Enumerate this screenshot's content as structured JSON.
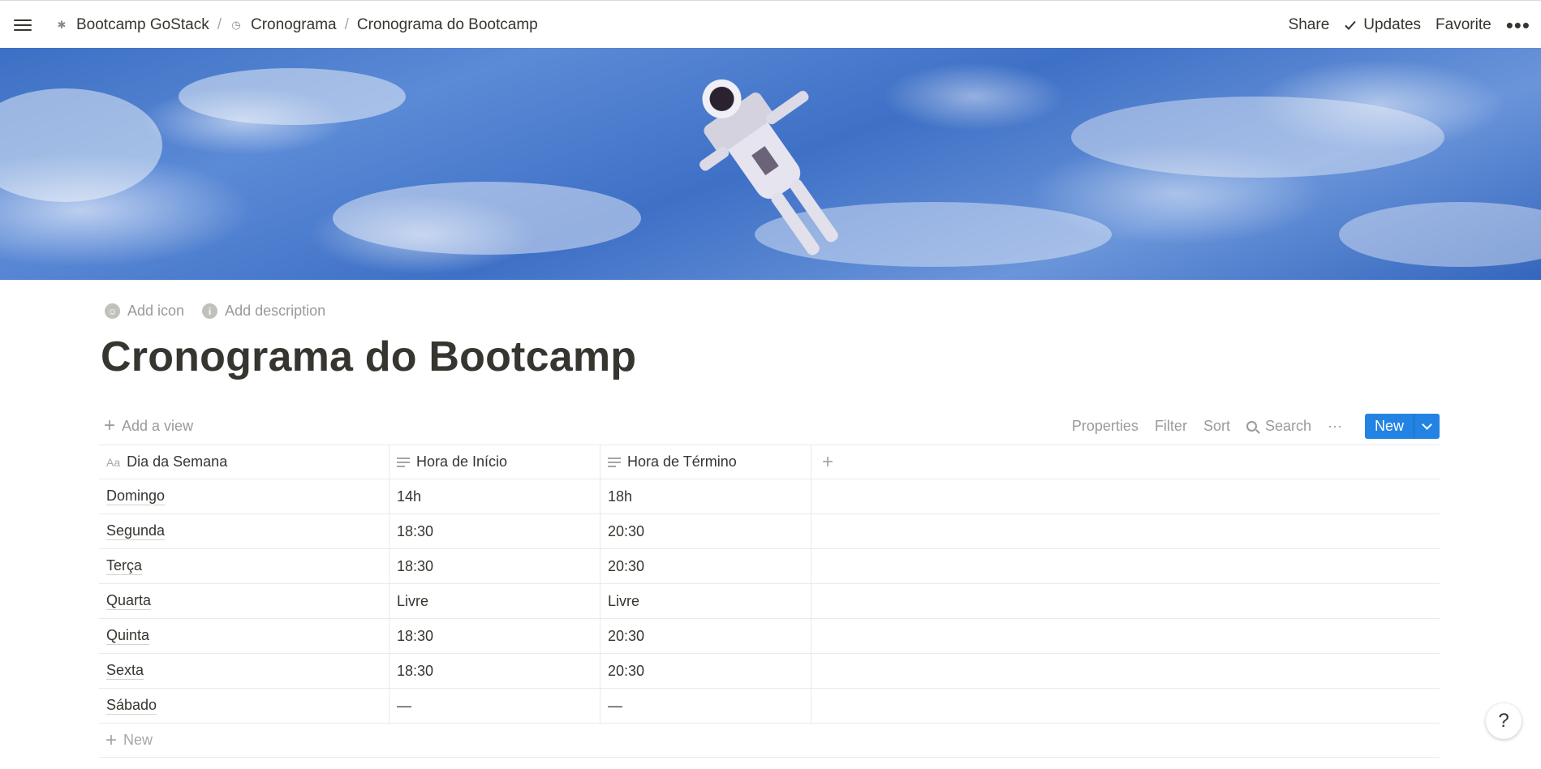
{
  "topbar": {
    "breadcrumbs": [
      {
        "label": "Bootcamp GoStack",
        "icon": "workspace-icon"
      },
      {
        "label": "Cronograma",
        "icon": "clock-icon"
      },
      {
        "label": "Cronograma do Bootcamp"
      }
    ],
    "separator": "/",
    "actions": {
      "share": "Share",
      "updates": "Updates",
      "favorite": "Favorite",
      "more": "•••"
    }
  },
  "page": {
    "add_icon": "Add icon",
    "add_description": "Add description",
    "title": "Cronograma do Bootcamp"
  },
  "viewbar": {
    "add_view": "Add a view",
    "properties": "Properties",
    "filter": "Filter",
    "sort": "Sort",
    "search": "Search",
    "more": "···",
    "new": "New"
  },
  "table": {
    "columns": [
      {
        "label": "Dia da Semana",
        "icon": "Aa"
      },
      {
        "label": "Hora de Início",
        "icon": "text-lines-icon"
      },
      {
        "label": "Hora de Término",
        "icon": "text-lines-icon"
      }
    ],
    "add_column": "+",
    "rows": [
      [
        "Domingo",
        "14h",
        "18h"
      ],
      [
        "Segunda",
        "18:30",
        "20:30"
      ],
      [
        "Terça",
        "18:30",
        "20:30"
      ],
      [
        "Quarta",
        "Livre",
        "Livre"
      ],
      [
        "Quinta",
        "18:30",
        "20:30"
      ],
      [
        "Sexta",
        "18:30",
        "20:30"
      ],
      [
        "Sábado",
        "—",
        "—"
      ]
    ],
    "new_row": "New"
  },
  "help": "?",
  "colors": {
    "accent": "#2383e2",
    "text": "#37352f",
    "muted": "#9b9a97"
  }
}
